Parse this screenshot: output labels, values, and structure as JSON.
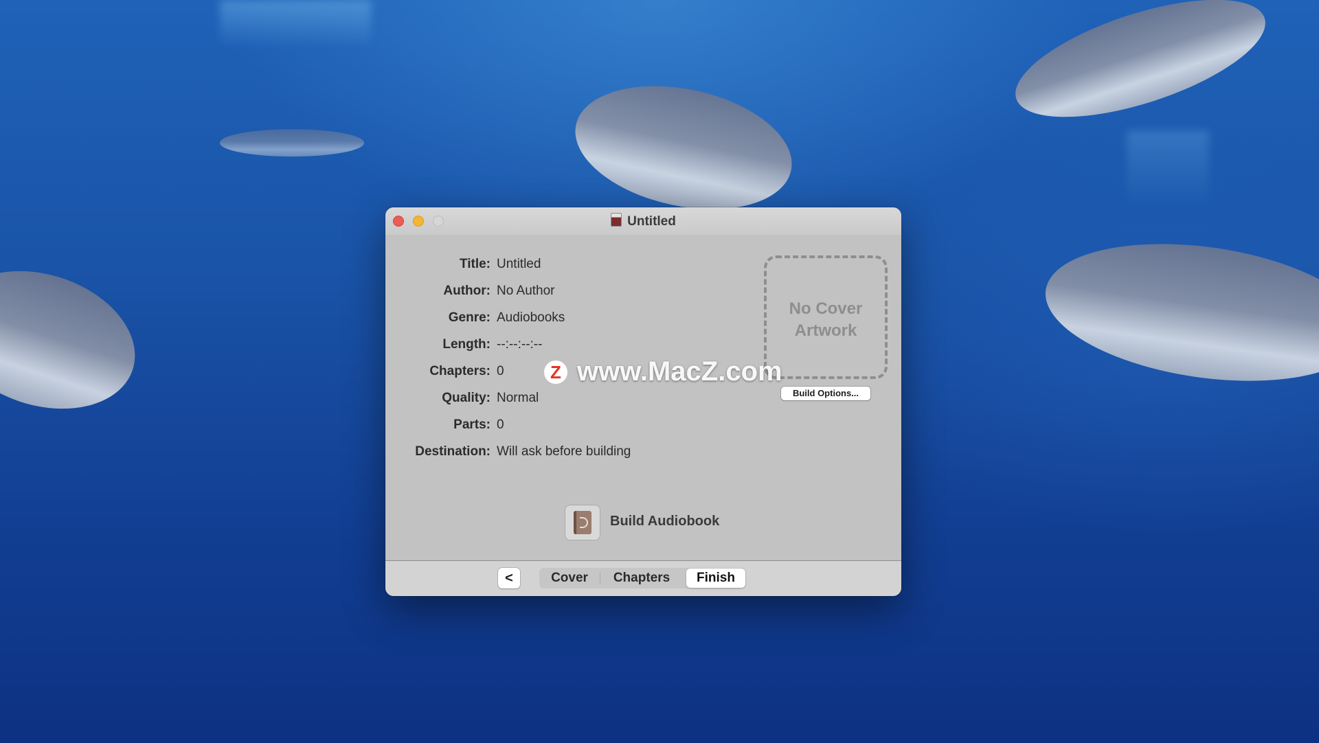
{
  "window": {
    "title": "Untitled"
  },
  "info": [
    {
      "label": "Title:",
      "value": "Untitled"
    },
    {
      "label": "Author:",
      "value": "No Author"
    },
    {
      "label": "Genre:",
      "value": "Audiobooks"
    },
    {
      "label": "Length:",
      "value": "--:--:--:--"
    },
    {
      "label": "Chapters:",
      "value": "0"
    },
    {
      "label": "Quality:",
      "value": "Normal"
    },
    {
      "label": "Parts:",
      "value": "0"
    },
    {
      "label": "Destination:",
      "value": "Will ask before building"
    }
  ],
  "cover": {
    "placeholder_line1": "No Cover",
    "placeholder_line2": "Artwork",
    "build_options_label": "Build Options..."
  },
  "build": {
    "label": "Build Audiobook"
  },
  "nav": {
    "back_label": "<",
    "tabs": [
      "Cover",
      "Chapters",
      "Finish"
    ],
    "selected": "Finish"
  },
  "watermark": {
    "logo": "Z",
    "text": "www.MacZ.com"
  },
  "colors": {
    "close": "#ec5b55",
    "minimize": "#f2b534",
    "zoom_disabled": "#d6d6d6",
    "window_bg": "#c2c2c2",
    "watermark_logo": "#e63323"
  }
}
